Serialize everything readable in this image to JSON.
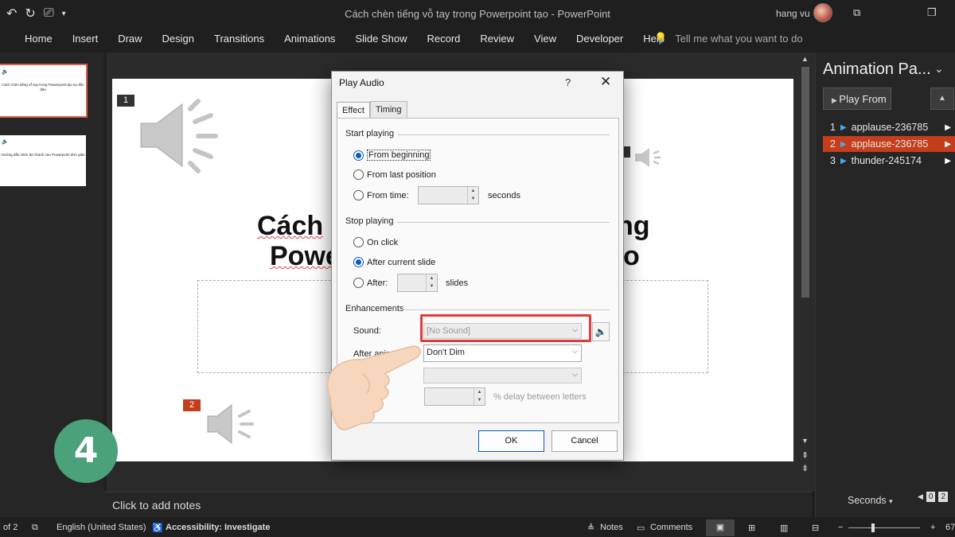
{
  "window": {
    "title": "Cách chèn tiếng vỗ tay trong Powerpoint tạo - PowerPoint",
    "user": "hang vu"
  },
  "ribbon": {
    "tabs": [
      "Home",
      "Insert",
      "Draw",
      "Design",
      "Transitions",
      "Animations",
      "Slide Show",
      "Record",
      "Review",
      "View",
      "Developer",
      "Help"
    ],
    "tell_me": "Tell me what you want to do"
  },
  "thumbnails": [
    {
      "text": "Cách chèn tiếng vỗ tay trong Powerpoint tạo sự độc đáo",
      "active": true
    },
    {
      "text": "Hướng dẫn chèn âm thanh vào Powerpoint đơn giản",
      "active": false
    }
  ],
  "slide": {
    "tags": [
      "1",
      "2"
    ],
    "title_line1": "Cách",
    "title_line1_end": "ng",
    "title_line2": "Powe",
    "title_line2_end": "o"
  },
  "notes": {
    "placeholder": "Click to add notes"
  },
  "animation_pane": {
    "title": "Animation Pa...",
    "play_from": "Play From",
    "items": [
      {
        "num": "1",
        "name": "applause-236785",
        "selected": false
      },
      {
        "num": "2",
        "name": "applause-236785",
        "selected": true
      },
      {
        "num": "3",
        "name": "thunder-245174",
        "selected": false
      }
    ],
    "seconds_label": "Seconds",
    "timeline": [
      "0",
      "2"
    ]
  },
  "status_bar": {
    "slide_of": "of 2",
    "language": "English (United States)",
    "accessibility": "Accessibility: Investigate",
    "notes": "Notes",
    "comments": "Comments",
    "zoom": "67"
  },
  "dialog": {
    "title": "Play Audio",
    "help": "?",
    "tabs": [
      "Effect",
      "Timing"
    ],
    "start_playing": {
      "label": "Start playing",
      "options": [
        "From beginning",
        "From last position",
        "From time:"
      ],
      "selected": "From beginning",
      "time_unit": "seconds"
    },
    "stop_playing": {
      "label": "Stop playing",
      "options": [
        "On click",
        "After current slide",
        "After:"
      ],
      "selected": "After current slide",
      "slides_unit": "slides"
    },
    "enhancements": {
      "label": "Enhancements",
      "sound_label": "Sound:",
      "sound_value": "[No Sound]",
      "after_animation_label": "After animation:",
      "after_animation_value": "Don't Dim",
      "delay_unit": "% delay between letters"
    },
    "ok": "OK",
    "cancel": "Cancel"
  },
  "step_badge": "4"
}
